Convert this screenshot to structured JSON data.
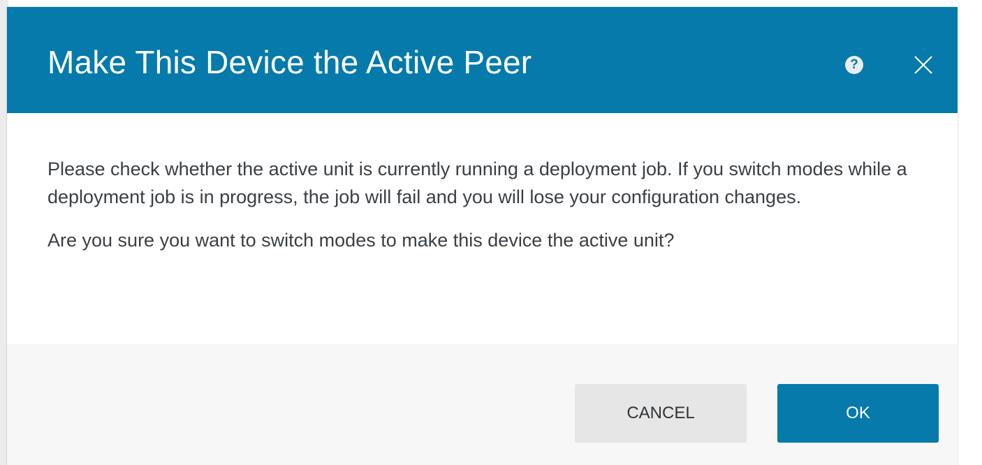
{
  "dialog": {
    "title": "Make This Device the Active Peer",
    "help_icon": "question-circle-icon",
    "help_glyph": "?",
    "close_icon": "close-icon",
    "message": "Please check whether the active unit is currently running a deployment job. If you switch modes while a deployment job is in progress, the job will fail and you will lose your configuration changes.",
    "question": "Are you sure you want to switch modes to make this device the active unit?",
    "buttons": {
      "cancel_label": "CANCEL",
      "ok_label": "OK"
    }
  },
  "colors": {
    "header_bg": "#057aab",
    "primary_button": "#057aab",
    "secondary_button": "#e6e6e6",
    "footer_bg": "#f7f7f7",
    "body_text": "#3a3f44"
  }
}
